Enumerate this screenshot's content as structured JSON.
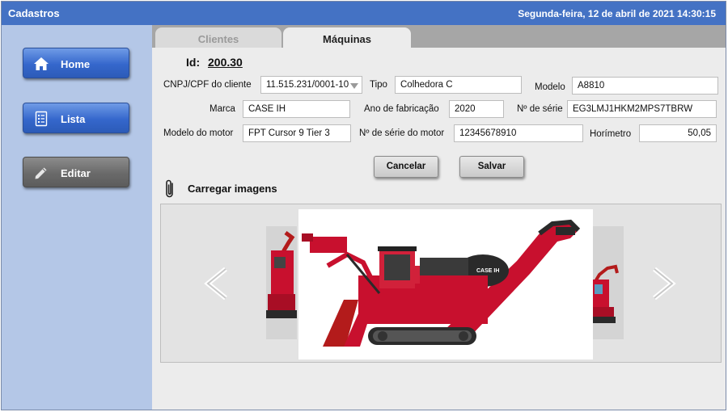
{
  "app": {
    "title": "Cadastros",
    "datetime": "Segunda-feira, 12 de abril de 2021 14:30:15"
  },
  "sidebar": {
    "items": [
      {
        "label": "Home",
        "icon": "home-icon"
      },
      {
        "label": "Lista",
        "icon": "list-icon"
      },
      {
        "label": "Editar",
        "icon": "pencil-icon"
      }
    ]
  },
  "tabs": [
    {
      "label": "Clientes",
      "active": false
    },
    {
      "label": "Máquinas",
      "active": true
    }
  ],
  "form": {
    "id_label": "Id:",
    "id_value": "200.30",
    "cnpj_label": "CNPJ/CPF do cliente",
    "cnpj_value": "11.515.231/0001-10",
    "tipo_label": "Tipo",
    "tipo_value": "Colhedora C",
    "modelo_label": "Modelo",
    "modelo_value": "A8810",
    "marca_label": "Marca",
    "marca_value": "CASE IH",
    "ano_label": "Ano de fabricação",
    "ano_value": "2020",
    "serie_label": "Nº de série",
    "serie_value": "EG3LMJ1HKM2MPS7TBRW",
    "motor_label": "Modelo do motor",
    "motor_value": "FPT Cursor 9 Tier 3",
    "serie_motor_label": "Nº de série do motor",
    "serie_motor_value": "12345678910",
    "horimetro_label": "Horímetro",
    "horimetro_value": "50,05"
  },
  "actions": {
    "cancel_label": "Cancelar",
    "save_label": "Salvar"
  },
  "upload": {
    "label": "Carregar imagens",
    "icon": "paperclip-icon"
  },
  "gallery": {
    "image_text": "CASE IH",
    "prev_icon": "chevron-left-icon",
    "next_icon": "chevron-right-icon"
  },
  "colors": {
    "title_bar": "#4472c4",
    "sidebar": "#b4c7e7",
    "button_blue": "#3567cc",
    "button_gray": "#6a6a6a",
    "machine_red": "#c8102e"
  }
}
